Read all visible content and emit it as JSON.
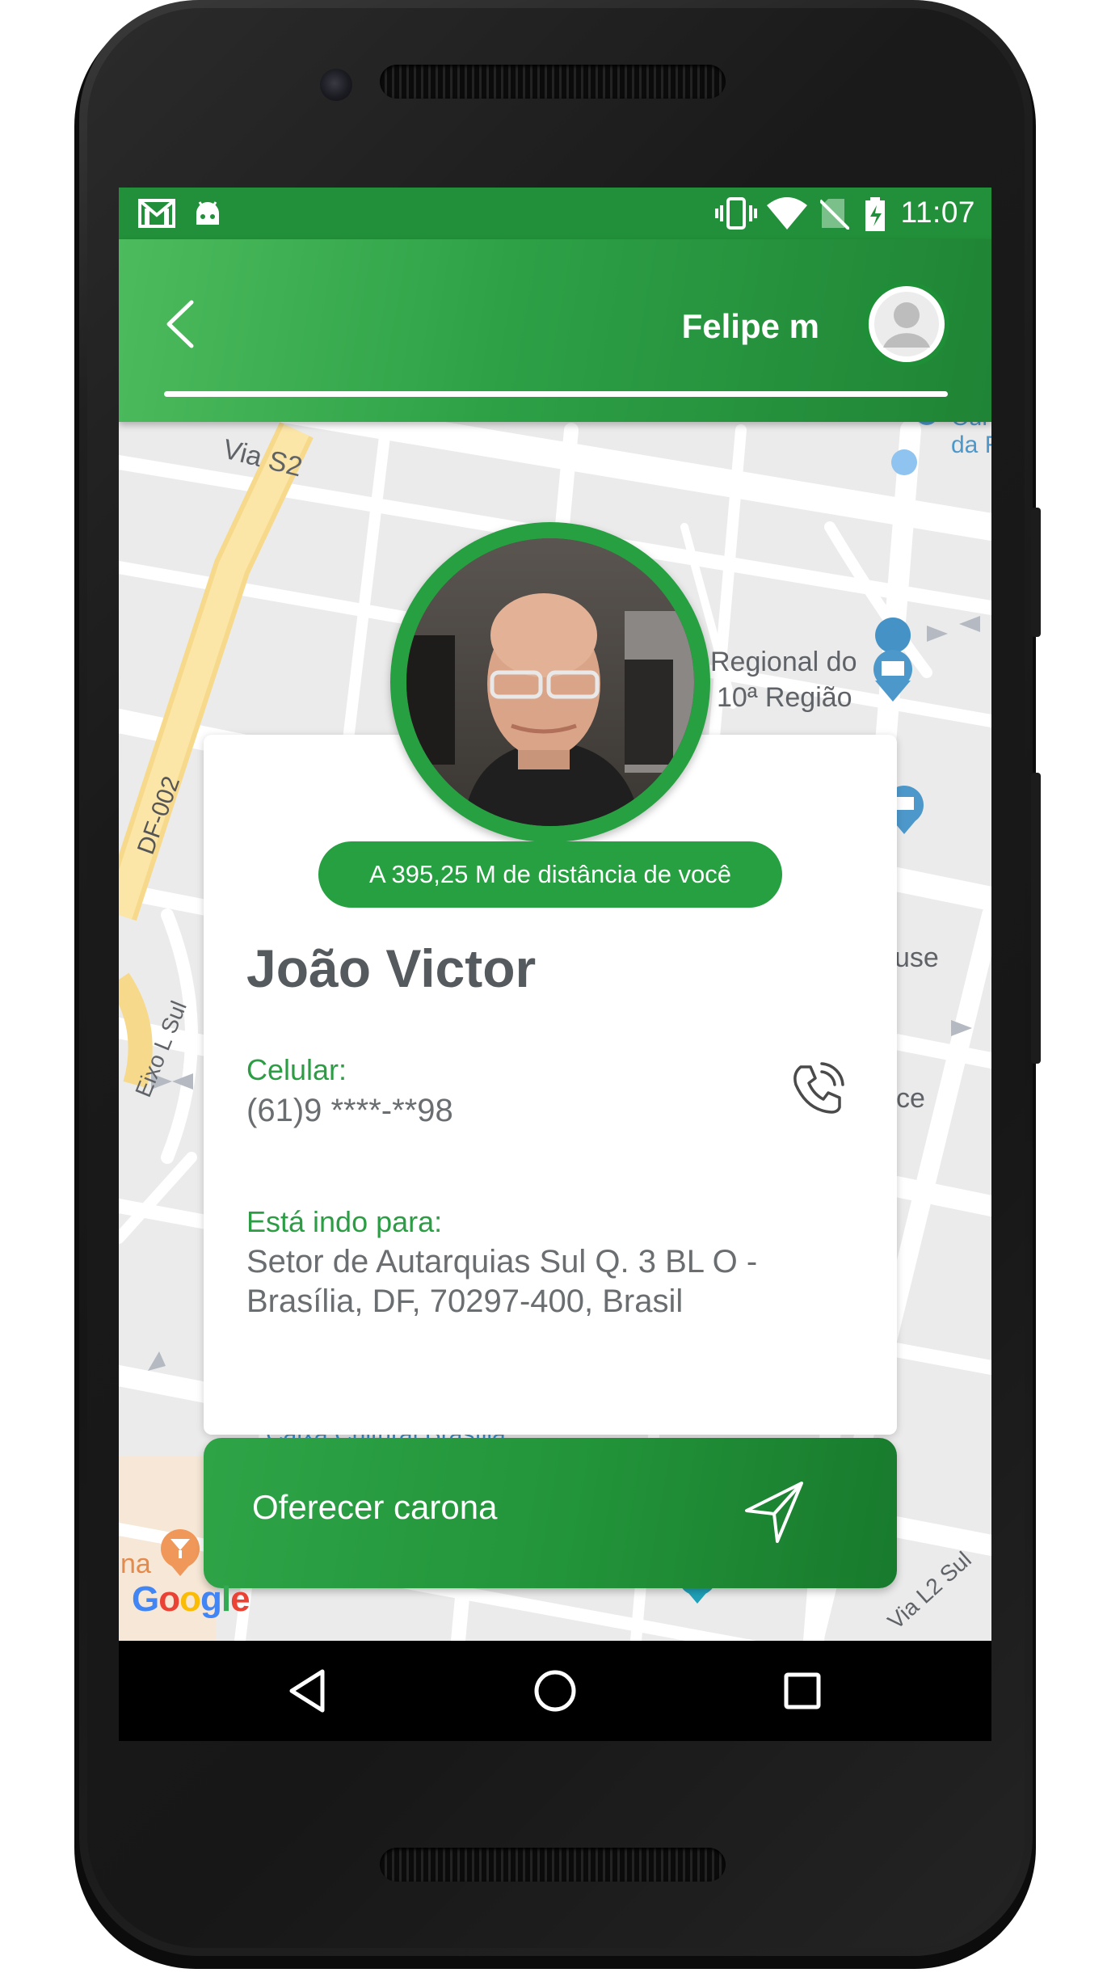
{
  "status_bar": {
    "time": "11:07",
    "icons": [
      "gmail-icon",
      "android-debug-icon",
      "vibrate-icon",
      "wifi-icon",
      "no-sim-icon",
      "battery-charging-icon"
    ]
  },
  "header": {
    "user_name": "Felipe m",
    "back_icon": "chevron-left-icon",
    "avatar_icon": "user-avatar-icon"
  },
  "map": {
    "labels": {
      "via_s2": "Via S2",
      "df_002": "DF-002",
      "regional_line1": "Regional do",
      "regional_line2": "10ª Região",
      "eixo": "Eixo L Sul",
      "use": "use",
      "ce": "ce",
      "caixa": "Caixa Cultural Brasília",
      "na": "na",
      "via_l2": "Via L2 Sul",
      "top_right1": "Cul",
      "top_right2": "da R"
    },
    "google": [
      "G",
      "o",
      "o",
      "g",
      "l",
      "e"
    ]
  },
  "profile": {
    "distance": "A 395,25 M de distância de você",
    "name": "João Victor",
    "phone_label": "Celular:",
    "phone_value": "(61)9 ****-**98",
    "destination_label": "Está indo para:",
    "destination_line1": "Setor de Autarquias Sul Q. 3 BL O -",
    "destination_line2": "Brasília, DF, 70297-400, Brasil"
  },
  "actions": {
    "offer_ride": "Oferecer carona"
  },
  "colors": {
    "primary": "#26a040",
    "primary_dark": "#187a2d",
    "label_green": "#2c9d45",
    "text_gray": "#6a6e71"
  }
}
